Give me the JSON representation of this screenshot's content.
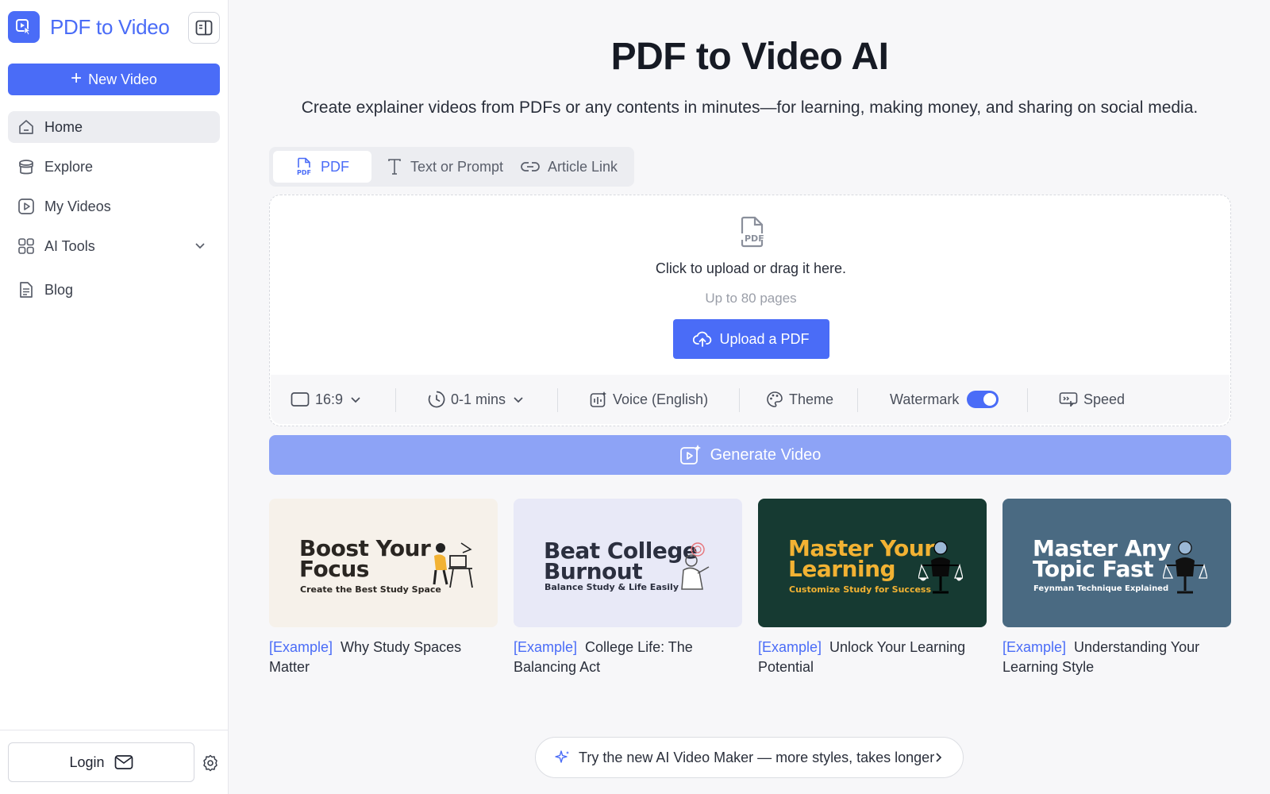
{
  "brand": {
    "name": "PDF to Video"
  },
  "sidebar": {
    "new_video_label": "New Video",
    "items": [
      {
        "label": "Home",
        "icon": "home-icon"
      },
      {
        "label": "Explore",
        "icon": "explore-icon"
      },
      {
        "label": "My Videos",
        "icon": "video-icon"
      },
      {
        "label": "AI Tools",
        "icon": "grid-icon"
      },
      {
        "label": "Blog",
        "icon": "document-icon"
      }
    ],
    "login_label": "Login"
  },
  "main": {
    "title": "PDF to Video AI",
    "subtitle": "Create explainer videos from PDFs or any contents in minutes—for learning, making money, and sharing on social media.",
    "tabs": [
      {
        "label": "PDF",
        "active": true
      },
      {
        "label": "Text or Prompt",
        "active": false
      },
      {
        "label": "Article Link",
        "active": false
      }
    ],
    "upload": {
      "prompt": "Click to upload or drag it here.",
      "hint": "Up to 80 pages",
      "button_label": "Upload a PDF"
    },
    "options": {
      "aspect_ratio": "16:9",
      "duration": "0-1 mins",
      "voice": "Voice (English)",
      "theme": "Theme",
      "watermark": "Watermark",
      "watermark_on": true,
      "speed": "Speed"
    },
    "generate_label": "Generate Video",
    "examples": [
      {
        "tag": "[Example]",
        "caption": "Why Study Spaces Matter",
        "thumb_title_1": "Boost Your",
        "thumb_title_2": "Focus",
        "thumb_sub": "Create the Best Study Space"
      },
      {
        "tag": "[Example]",
        "caption": "College Life: The Balancing Act",
        "thumb_title_1": "Beat College",
        "thumb_title_2": "Burnout",
        "thumb_sub": "Balance Study & Life Easily"
      },
      {
        "tag": "[Example]",
        "caption": "Unlock Your Learning Potential",
        "thumb_title_1": "Master Your",
        "thumb_title_2": "Learning",
        "thumb_sub": "Customize Study for Success"
      },
      {
        "tag": "[Example]",
        "caption": "Understanding Your Learning Style",
        "thumb_title_1": "Master Any",
        "thumb_title_2": "Topic Fast",
        "thumb_sub": "Feynman Technique Explained"
      }
    ],
    "promo": "Try the new AI Video Maker — more styles, takes longer"
  },
  "colors": {
    "accent": "#4a6cf7",
    "generate_disabled": "#8da3f6"
  }
}
